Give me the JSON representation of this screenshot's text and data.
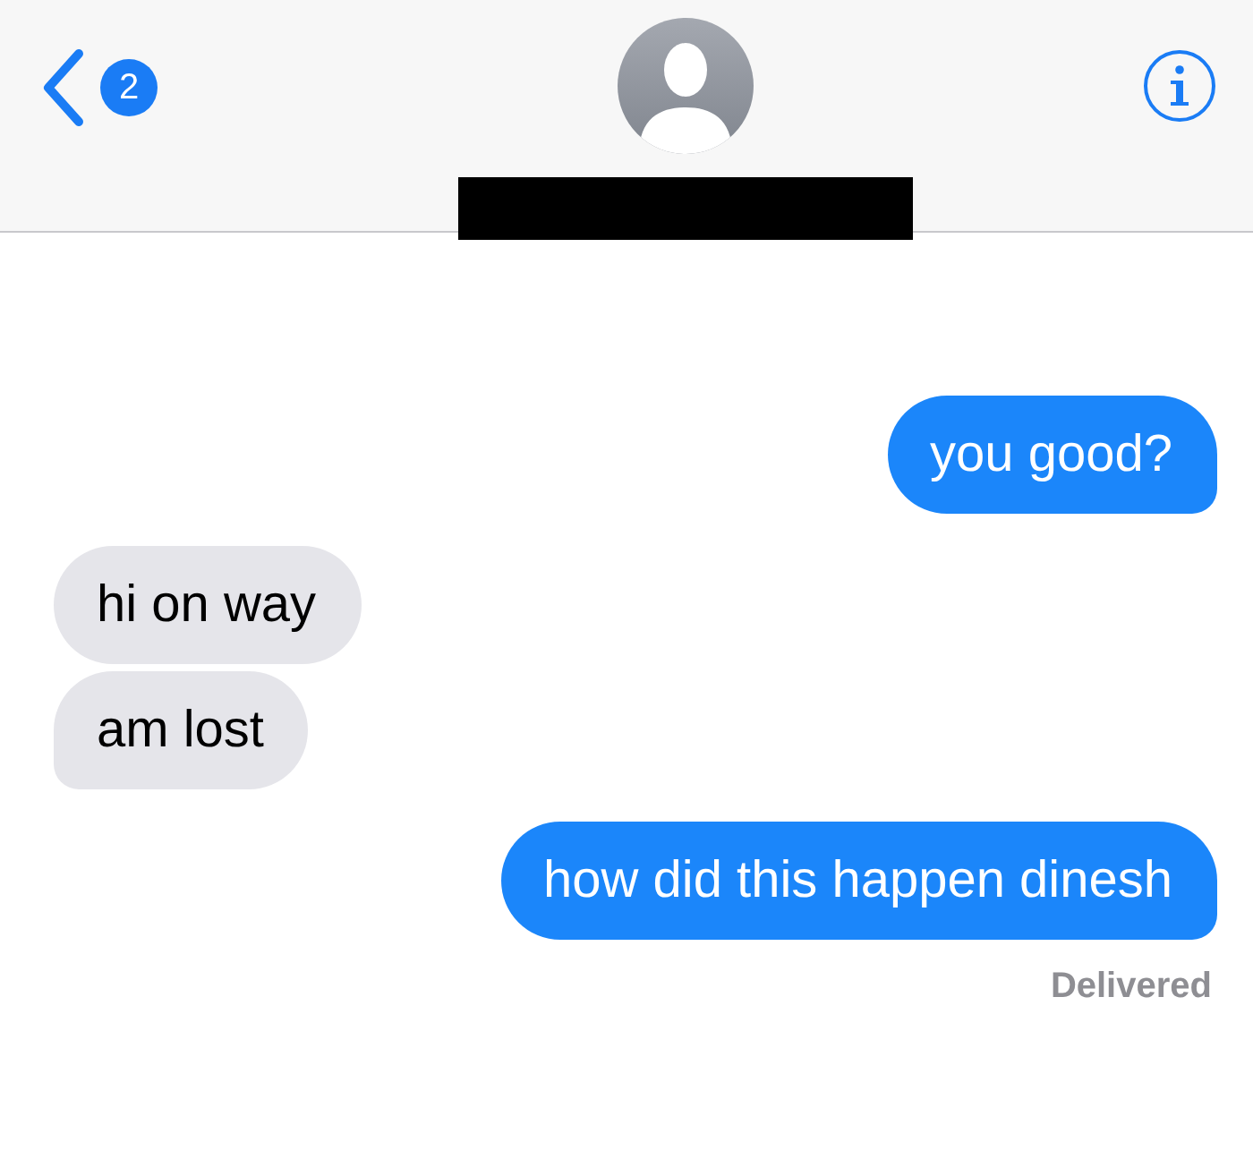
{
  "header": {
    "back_badge": "2",
    "contact_name_redacted": true
  },
  "messages": [
    {
      "text": "you good?",
      "kind": "outgoing",
      "tail": true
    },
    {
      "text": "hi on way",
      "kind": "incoming",
      "tail": false
    },
    {
      "text": "am lost",
      "kind": "incoming",
      "tail": true
    },
    {
      "text": "how did this happen dinesh",
      "kind": "outgoing",
      "tail": true
    }
  ],
  "status": "Delivered"
}
